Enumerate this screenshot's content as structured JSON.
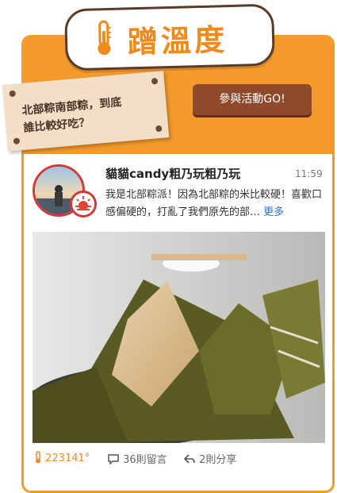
{
  "header": {
    "title": "蹭溫度",
    "icon": "thermometer-icon",
    "accent_color": "#f39a2a"
  },
  "note": {
    "line1": "北部粽南部粽，到底",
    "line2": "誰比較好吃？"
  },
  "cta": {
    "label": "參與活動GO!"
  },
  "post": {
    "username": "貓貓candy粗乃玩粗乃玩",
    "time": "11:59",
    "text": "我是北部粽派！因為北部粽的米比較硬！喜歡口感偏硬的，打亂了我們原先的部…",
    "more_label": "更多",
    "image": "zongzi-photo"
  },
  "footer": {
    "temperature": "223141°",
    "comments": "36則留言",
    "shares": "2則分享"
  }
}
